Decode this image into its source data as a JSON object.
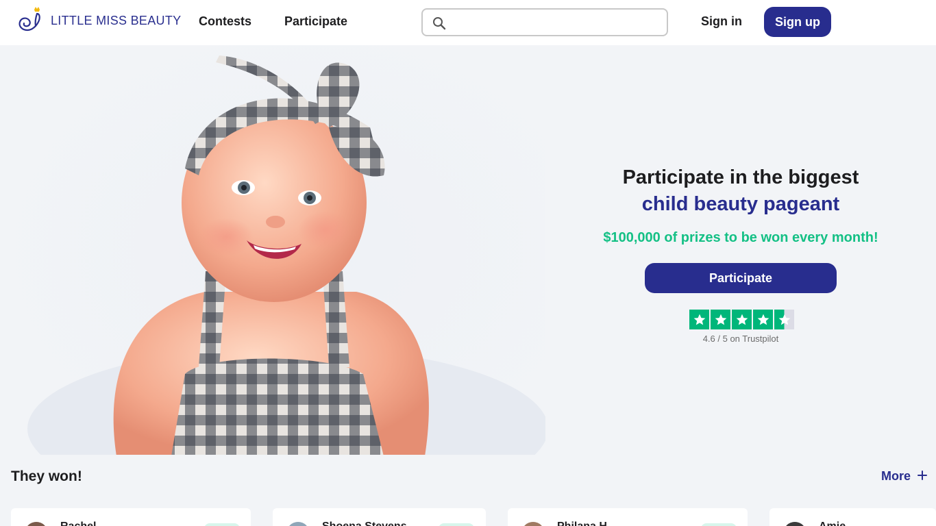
{
  "header": {
    "brand": "LITTLE MISS BEAUTY",
    "nav": [
      "Contests",
      "Participate"
    ],
    "search_placeholder": "",
    "signin_label": "Sign in",
    "signup_label": "Sign up"
  },
  "hero": {
    "title_line1": "Participate in the biggest",
    "title_line2": "child beauty pageant",
    "subtitle": "$100,000 of prizes to be won every month!",
    "cta_label": "Participate",
    "rating_text": "4.6 / 5 on Trustpilot",
    "rating_value": 4.6,
    "rating_max": 5,
    "image_alt": "smiling baby with checkered headband"
  },
  "winners": {
    "title": "They won!",
    "more_label": "More",
    "cards": [
      {
        "name": "Rachel"
      },
      {
        "name": "Shoena Stevens"
      },
      {
        "name": "Philana H."
      },
      {
        "name": "Amie"
      }
    ]
  },
  "colors": {
    "brand": "#282d8e",
    "accent_green": "#14c085",
    "trustpilot_green": "#00b67a",
    "background": "#f2f4f7"
  },
  "icons": {
    "search": "search-icon",
    "more": "plus-icon",
    "logo": "swan-crown-icon",
    "stars": "star-icon"
  }
}
